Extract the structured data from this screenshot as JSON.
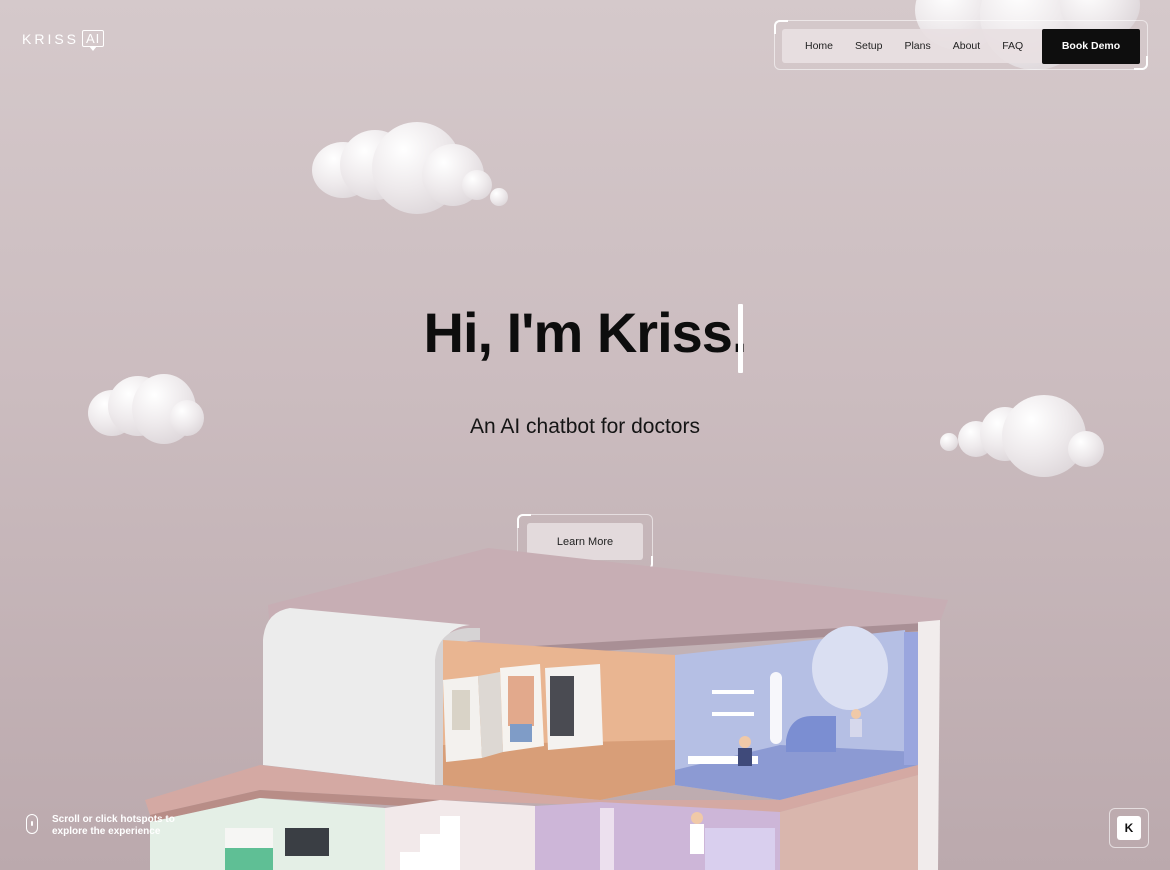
{
  "logo": {
    "text": "KRISS",
    "badge": "AI"
  },
  "nav": {
    "items": [
      "Home",
      "Setup",
      "Plans",
      "About",
      "FAQ"
    ],
    "cta": "Book Demo"
  },
  "hero": {
    "title": "Hi, I'm Kriss.",
    "subtitle": "An AI chatbot for doctors",
    "button": "Learn More"
  },
  "hint": {
    "text": "Scroll or click hotspots to explore the experience"
  },
  "corner_button": {
    "label": "K"
  },
  "colors": {
    "background": "#cbbcbf",
    "cta": "#0e0e0e",
    "accent": "#ffffff"
  }
}
